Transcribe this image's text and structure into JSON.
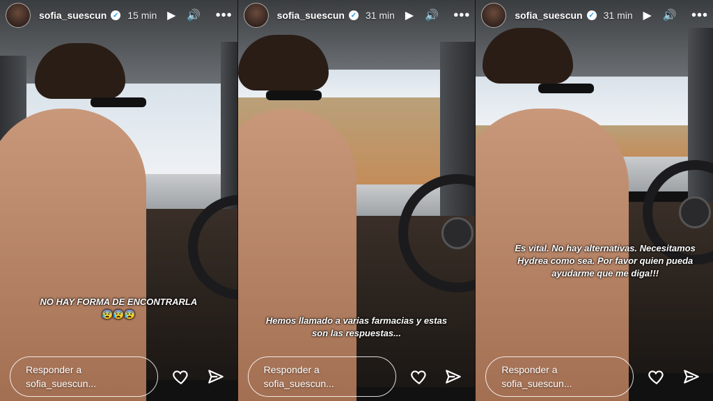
{
  "stories": [
    {
      "username": "sofia_suescun",
      "time": "15 min",
      "caption": "NO HAY FORMA DE ENCONTRARLA",
      "emojis": "😰😰😰",
      "reply_placeholder_line1": "Responder a",
      "reply_placeholder_line2": "sofia_suescun..."
    },
    {
      "username": "sofia_suescun",
      "time": "31 min",
      "caption": "Hemos llamado a varias farmacias y estas son las respuestas...",
      "emojis": "",
      "reply_placeholder_line1": "Responder a",
      "reply_placeholder_line2": "sofia_suescun..."
    },
    {
      "username": "sofia_suescun",
      "time": "31 min",
      "caption": "Es vital. No hay alternativas. Necesitamos Hydrea como sea. Por favor quien pueda ayudarme que me diga!!!",
      "emojis": "",
      "reply_placeholder_line1": "Responder a",
      "reply_placeholder_line2": "sofia_suescun..."
    }
  ],
  "icons": {
    "verified": "verified-badge-icon",
    "play": "play-icon",
    "volume": "volume-icon",
    "more": "more-options-icon",
    "like": "heart-icon",
    "share": "send-icon"
  }
}
